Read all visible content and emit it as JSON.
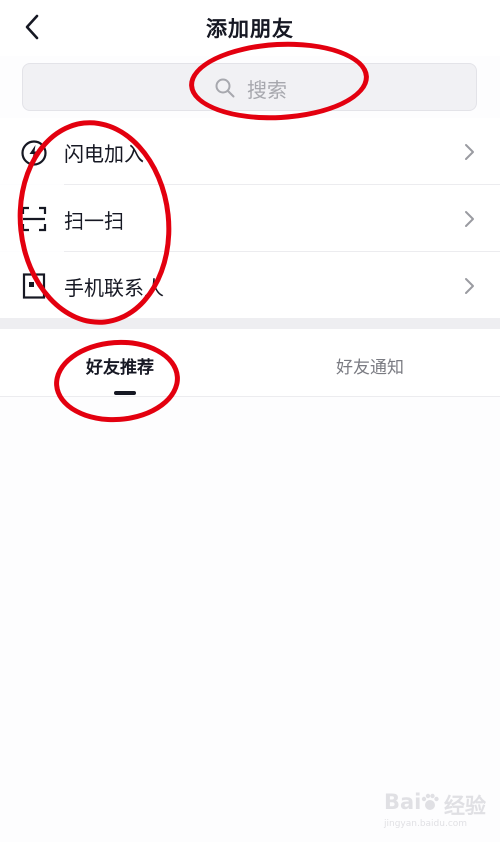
{
  "header": {
    "title": "添加朋友",
    "back_icon": "chevron-left-icon"
  },
  "search": {
    "placeholder": "搜索",
    "icon": "search-icon"
  },
  "menu": [
    {
      "label": "闪电加入",
      "icon": "lightning-circle-icon"
    },
    {
      "label": "扫一扫",
      "icon": "scan-icon"
    },
    {
      "label": "手机联系人",
      "icon": "contacts-book-icon"
    }
  ],
  "tabs": [
    {
      "label": "好友推荐",
      "active": true
    },
    {
      "label": "好友通知",
      "active": false
    }
  ],
  "annotation": {
    "color": "#e3000f",
    "shape": "ellipse"
  },
  "watermark": {
    "text": "Bai",
    "suffix": "经验",
    "sub": "jingyan.baidu.com"
  }
}
